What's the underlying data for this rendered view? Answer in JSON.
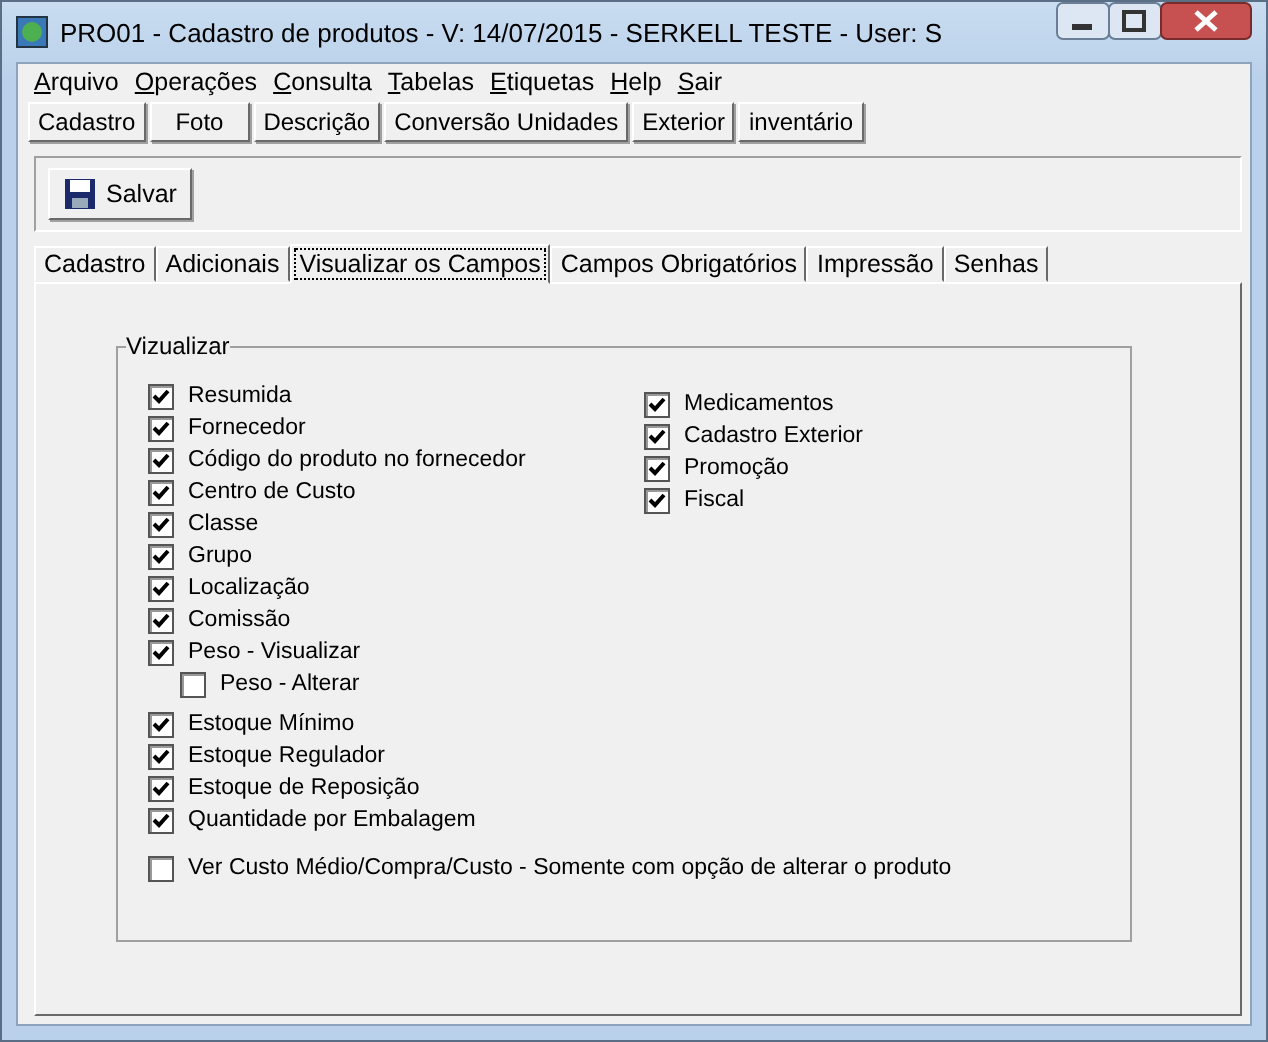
{
  "window": {
    "title": "PRO01 - Cadastro de produtos - V: 14/07/2015 - SERKELL TESTE - User: S"
  },
  "menu": [
    "Arquivo",
    "Operações",
    "Consulta",
    "Tabelas",
    "Etiquetas",
    "Help",
    "Sair"
  ],
  "buttons": [
    "Cadastro",
    "Foto",
    "Descrição",
    "Conversão Unidades",
    "Exterior",
    "inventário"
  ],
  "toolbar": {
    "save": "Salvar"
  },
  "tabs": [
    {
      "label": "Cadastro",
      "selected": false
    },
    {
      "label": "Adicionais",
      "selected": false
    },
    {
      "label": "Visualizar os Campos",
      "selected": true
    },
    {
      "label": "Campos Obrigatórios",
      "selected": false
    },
    {
      "label": "Impressão",
      "selected": false
    },
    {
      "label": "Senhas",
      "selected": false
    }
  ],
  "group": {
    "title": "Vizualizar",
    "left": [
      {
        "label": "Resumida",
        "checked": true
      },
      {
        "label": "Fornecedor",
        "checked": true
      },
      {
        "label": "Código do produto no fornecedor",
        "checked": true
      },
      {
        "label": "Centro de Custo",
        "checked": true
      },
      {
        "label": "Classe",
        "checked": true
      },
      {
        "label": "Grupo",
        "checked": true
      },
      {
        "label": "Localização",
        "checked": true
      },
      {
        "label": "Comissão",
        "checked": true
      },
      {
        "label": "Peso - Visualizar",
        "checked": true,
        "children": [
          {
            "label": "Peso - Alterar",
            "checked": false
          }
        ]
      },
      {
        "label": "Estoque Mínimo",
        "checked": true
      },
      {
        "label": "Estoque Regulador",
        "checked": true
      },
      {
        "label": "Estoque de Reposição",
        "checked": true
      },
      {
        "label": "Quantidade por Embalagem",
        "checked": true
      }
    ],
    "right": [
      {
        "label": "Medicamentos",
        "checked": true
      },
      {
        "label": "Cadastro Exterior",
        "checked": true
      },
      {
        "label": "Promoção",
        "checked": true
      },
      {
        "label": "Fiscal",
        "checked": true
      }
    ],
    "bottom": {
      "label": "Ver Custo Médio/Compra/Custo - Somente com opção de alterar o produto",
      "checked": false
    }
  }
}
